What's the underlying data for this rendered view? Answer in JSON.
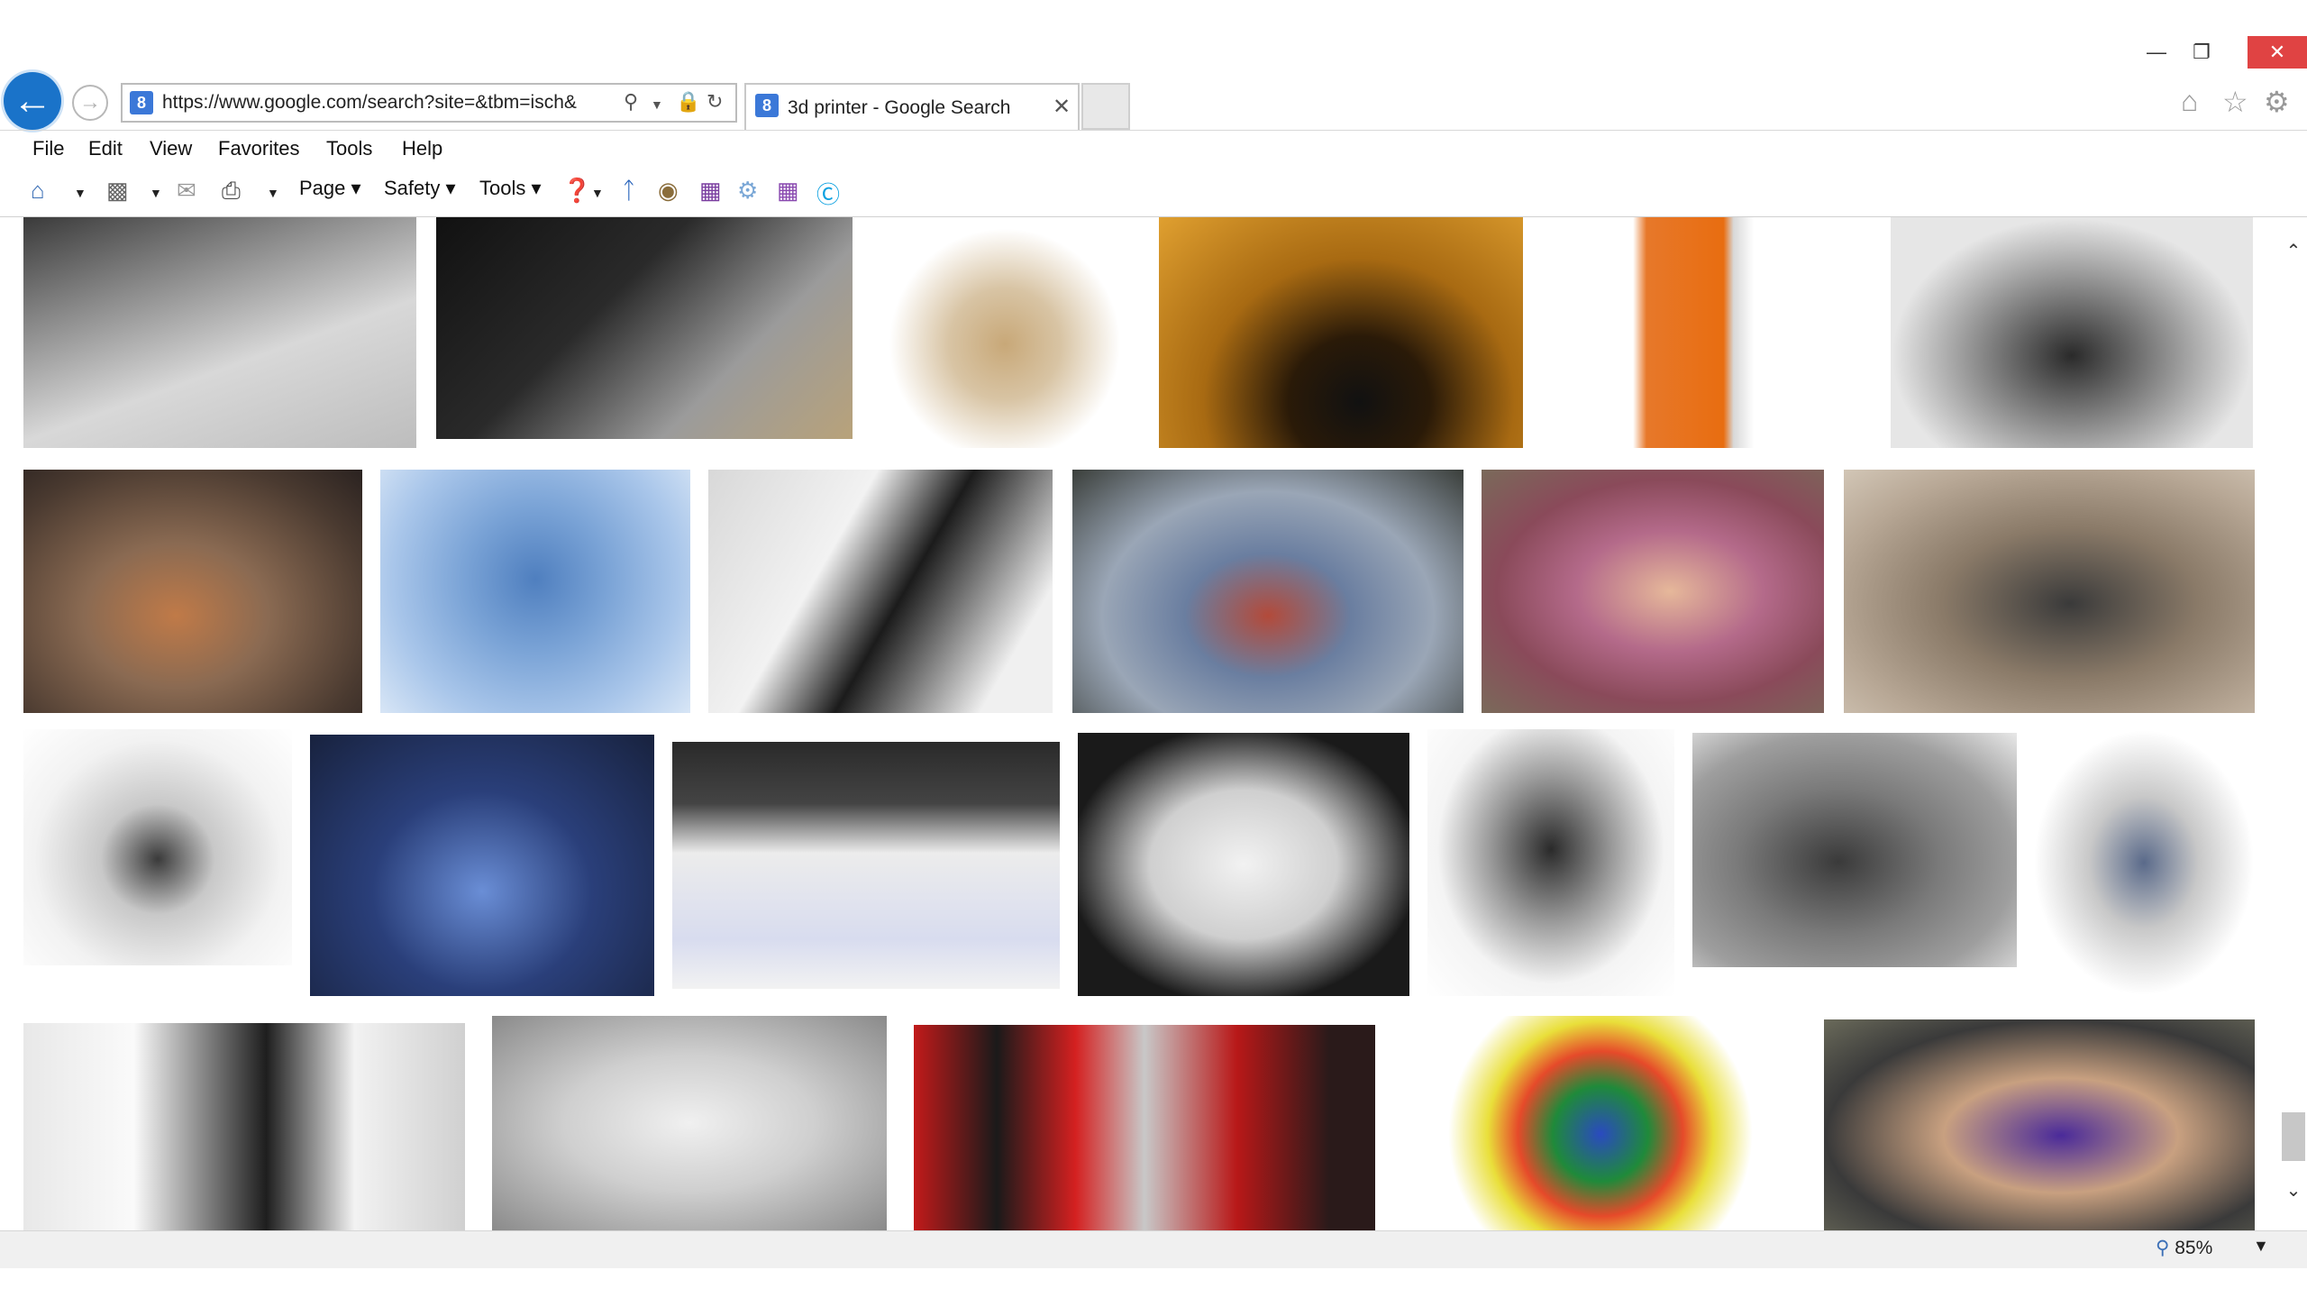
{
  "window": {
    "minimize_icon": "minimize-icon",
    "restore_icon": "restore-icon",
    "close_icon": "close-icon"
  },
  "address": {
    "url": "https://www.google.com/search?site=&tbm=isch&",
    "favicon": "8",
    "icons": [
      "search-icon",
      "dropdown-icon",
      "lock-icon",
      "refresh-icon"
    ]
  },
  "tab": {
    "title": "3d printer - Google Search",
    "favicon": "8",
    "close": "✕"
  },
  "right_tools": [
    "home-icon",
    "star-icon",
    "gear-icon"
  ],
  "menu": [
    "File",
    "Edit",
    "View",
    "Favorites",
    "Tools",
    "Help"
  ],
  "commands": {
    "page": "Page",
    "safety": "Safety",
    "tools": "Tools"
  },
  "status": {
    "zoom": "85%"
  },
  "colors": {
    "accent": "#1a73c9",
    "close": "#e04343"
  },
  "images": [
    {
      "name": "resin-pour"
    },
    {
      "name": "knife-parts"
    },
    {
      "name": "ultimaker-printer"
    },
    {
      "name": "resin-platform"
    },
    {
      "name": "orange-resin-printer"
    },
    {
      "name": "tray-print"
    },
    {
      "name": "tank-models"
    },
    {
      "name": "blue-gears"
    },
    {
      "name": "robo-3d"
    },
    {
      "name": "factory-model"
    },
    {
      "name": "kids-exoskeleton"
    },
    {
      "name": "frame-printer"
    },
    {
      "name": "white-box-printer"
    },
    {
      "name": "blue-enclosure"
    },
    {
      "name": "dlp-printer"
    },
    {
      "name": "fetus-sculpture"
    },
    {
      "name": "cel-robox"
    },
    {
      "name": "mojo-printer"
    },
    {
      "name": "prusa-frame"
    },
    {
      "name": "desktop-mills"
    },
    {
      "name": "lace-benches"
    },
    {
      "name": "red-printer"
    },
    {
      "name": "filament-spools"
    },
    {
      "name": "hand-print"
    }
  ]
}
